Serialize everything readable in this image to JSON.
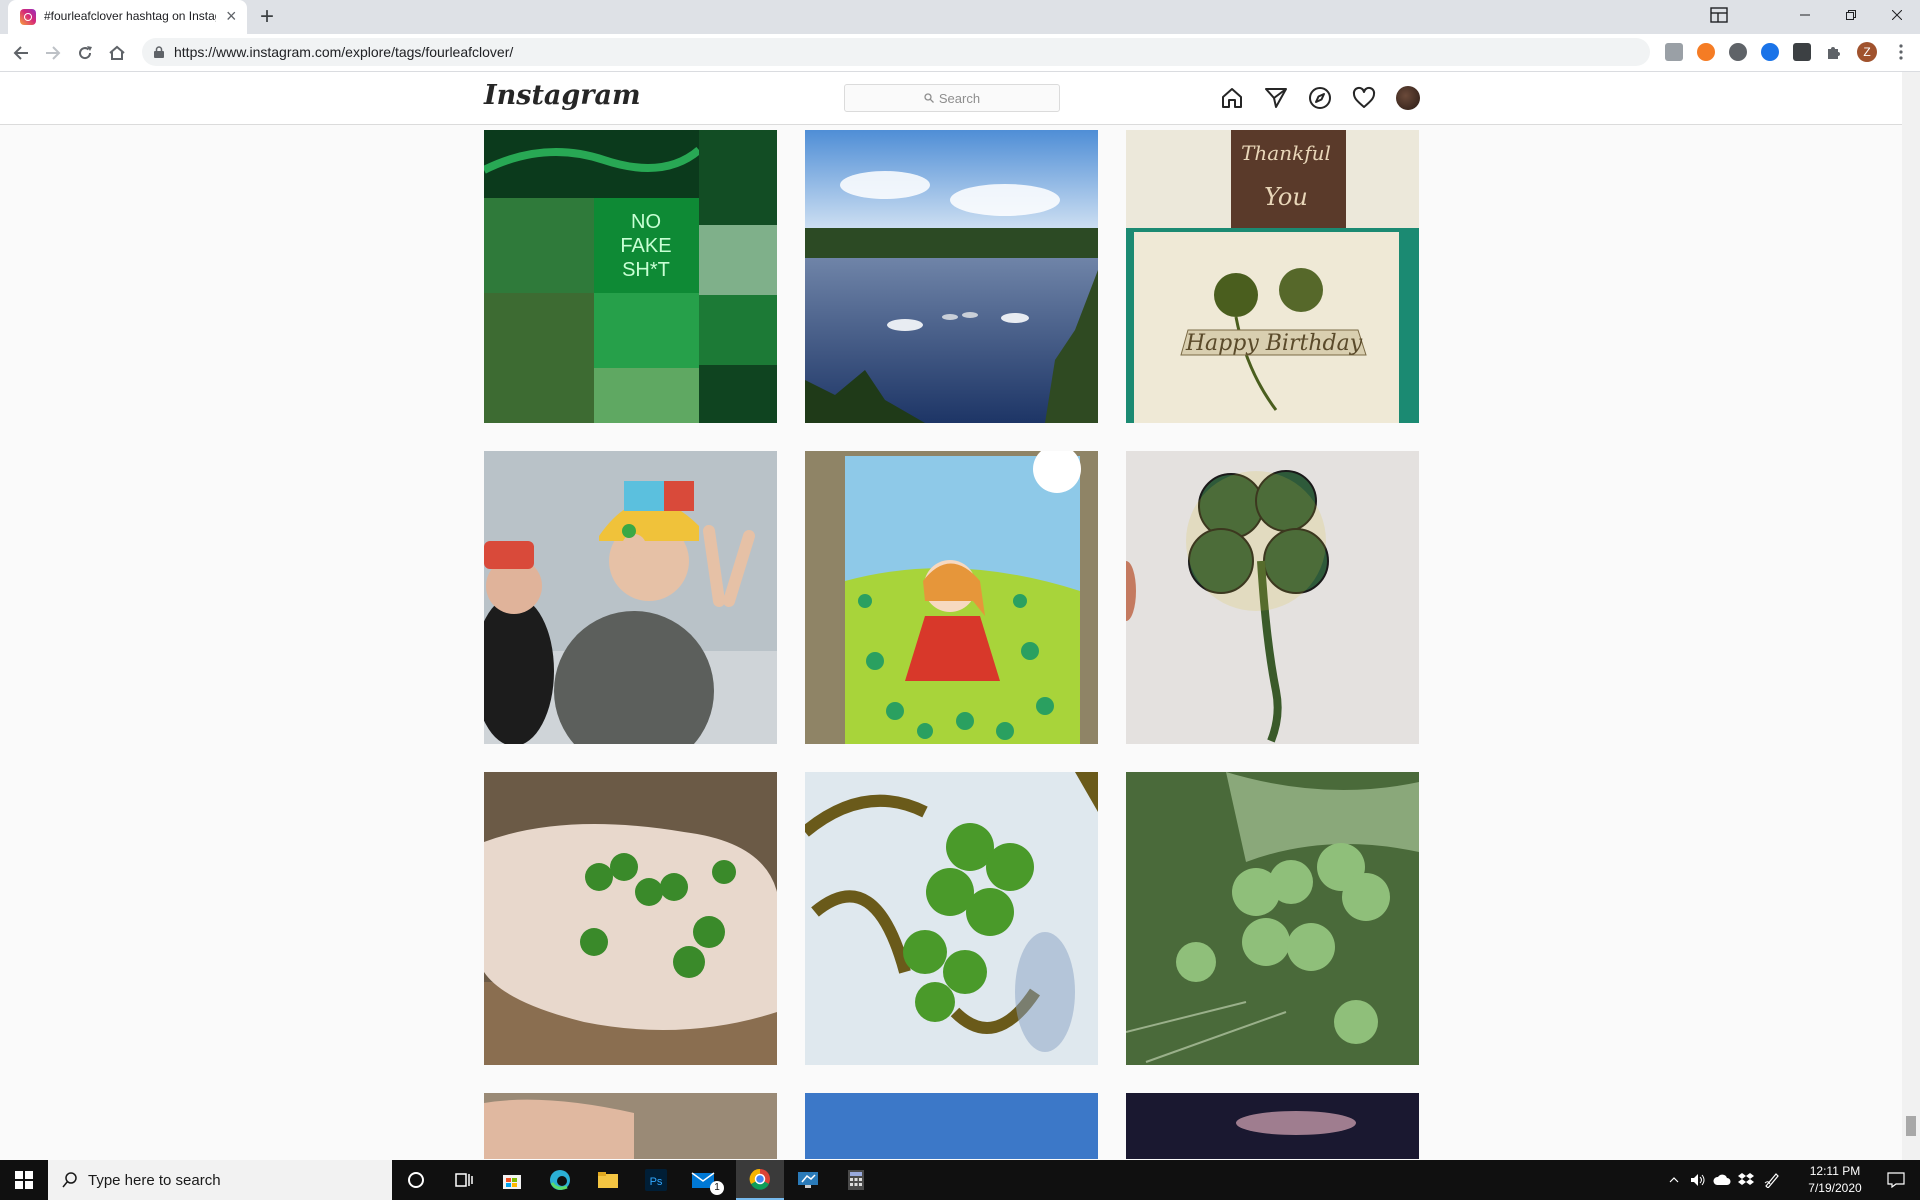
{
  "browser": {
    "tab_title": "#fourleafclover hashtag on Instagram",
    "new_tab_label": "+",
    "url": "https://www.instagram.com/explore/tags/fourleafclover/",
    "profile_initial": "Z"
  },
  "instagram": {
    "logo": "Instagram",
    "search_placeholder": "Search",
    "nav_icons": [
      "home-icon",
      "direct-icon",
      "explore-icon",
      "activity-icon",
      "profile-avatar"
    ]
  },
  "posts": [
    {
      "description": "green aesthetic collage"
    },
    {
      "description": "swans on a lake"
    },
    {
      "description": "happy birthday clover card"
    },
    {
      "description": "children holding clover"
    },
    {
      "description": "watercolor girl in clover field"
    },
    {
      "description": "drawn four leaf clover"
    },
    {
      "description": "clovers in hand"
    },
    {
      "description": "clover over lettering"
    },
    {
      "description": "clover patch"
    },
    {
      "description": "partial post"
    },
    {
      "description": "partial post"
    },
    {
      "description": "partial post"
    }
  ],
  "taskbar": {
    "search_placeholder": "Type here to search",
    "time": "12:11 PM",
    "date": "7/19/2020",
    "mail_badge": "1"
  },
  "colors": {
    "tab_strip": "#dee1e6",
    "taskbar": "#101010",
    "ig_border": "#dbdbdb"
  }
}
